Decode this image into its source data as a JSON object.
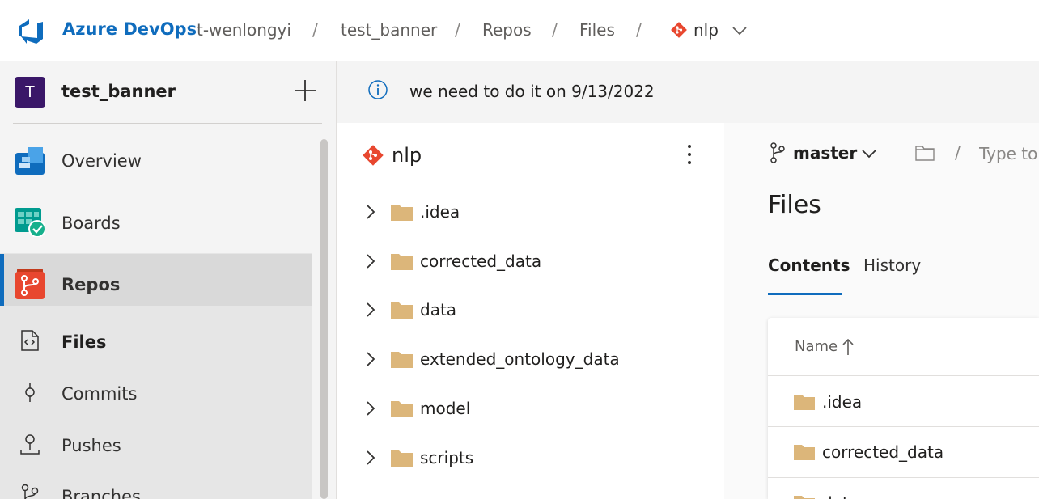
{
  "header": {
    "brand": "Azure DevOps",
    "breadcrumbs": [
      "t-wenlongyi",
      "test_banner",
      "Repos",
      "Files",
      "nlp"
    ],
    "separator": "/"
  },
  "sidebar": {
    "project_initial": "T",
    "project_name": "test_banner",
    "items": [
      {
        "label": "Overview",
        "icon": "overview-icon"
      },
      {
        "label": "Boards",
        "icon": "boards-icon"
      },
      {
        "label": "Repos",
        "icon": "repos-icon"
      },
      {
        "label": "Files",
        "icon": "files-icon",
        "active": true
      },
      {
        "label": "Commits",
        "icon": "commits-icon"
      },
      {
        "label": "Pushes",
        "icon": "pushes-icon"
      },
      {
        "label": "Branches",
        "icon": "branches-icon"
      }
    ]
  },
  "banner": {
    "text": "we need to do it on 9/13/2022"
  },
  "tree": {
    "repo_name": "nlp",
    "items": [
      ".idea",
      "corrected_data",
      "data",
      "extended_ontology_data",
      "model",
      "scripts"
    ]
  },
  "main": {
    "branch": "master",
    "path_placeholder": "Type to",
    "path_separator": "/",
    "heading": "Files",
    "tabs": [
      "Contents",
      "History"
    ],
    "column_name": "Name",
    "rows": [
      ".idea",
      "corrected_data",
      "data"
    ]
  },
  "colors": {
    "accent": "#0f6cbd",
    "folder": "#dcb67a",
    "git": "#e8472f"
  }
}
